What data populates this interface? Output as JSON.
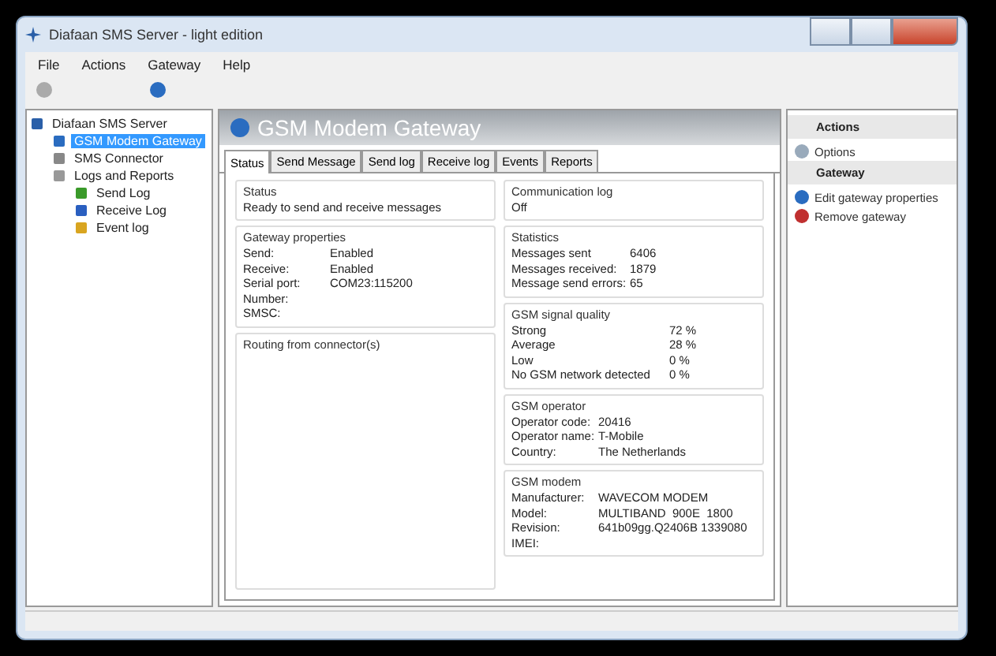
{
  "window": {
    "title": "Diafaan SMS Server - light edition"
  },
  "menu": [
    "File",
    "Actions",
    "Gateway",
    "Help"
  ],
  "tree": [
    {
      "label": "Diafaan SMS Server",
      "selected": false,
      "children": [
        {
          "label": "GSM Modem Gateway",
          "selected": true
        },
        {
          "label": "SMS Connector",
          "selected": false
        },
        {
          "label": "Logs and Reports",
          "selected": false,
          "children": [
            {
              "label": "Send Log",
              "selected": false
            },
            {
              "label": "Receive Log",
              "selected": false
            },
            {
              "label": "Event log",
              "selected": false
            }
          ]
        }
      ]
    }
  ],
  "header": {
    "title": "GSM Modem Gateway"
  },
  "tabs": [
    {
      "label": "Status",
      "selected": true
    },
    {
      "label": "Send Message",
      "selected": false
    },
    {
      "label": "Send log",
      "selected": false
    },
    {
      "label": "Receive log",
      "selected": false
    },
    {
      "label": "Events",
      "selected": false
    },
    {
      "label": "Reports",
      "selected": false
    }
  ],
  "left_groups": [
    {
      "title": "Status",
      "kind": "text",
      "text": "Ready to send and receive messages"
    },
    {
      "title": "Gateway properties",
      "kind": "pairs",
      "rows": [
        [
          "Send:",
          "Enabled"
        ],
        [
          "Receive:",
          "Enabled"
        ],
        [
          "Serial port:",
          "COM23:115200"
        ],
        [
          "Number:",
          ""
        ],
        [
          "SMSC:",
          ""
        ]
      ]
    },
    {
      "title": "Routing from connector(s)",
      "kind": "fill"
    }
  ],
  "right_groups": [
    {
      "title": "Communication log",
      "kind": "text",
      "text": "Off"
    },
    {
      "title": "Statistics",
      "kind": "stats",
      "rows": [
        [
          "Messages sent",
          "6406"
        ],
        [
          "Messages received:",
          "1879"
        ],
        [
          "Message send errors:",
          "65"
        ]
      ]
    },
    {
      "title": "GSM signal quality",
      "kind": "wide",
      "rows": [
        [
          "Strong",
          "72 %"
        ],
        [
          "Average",
          "28 %"
        ],
        [
          "Low",
          "0 %"
        ],
        [
          "No GSM network detected",
          "0 %"
        ]
      ]
    },
    {
      "title": "GSM operator",
      "kind": "pairs",
      "rows": [
        [
          "Operator code:",
          "20416"
        ],
        [
          "Operator name:",
          "T-Mobile"
        ],
        [
          "Country:",
          "The Netherlands"
        ]
      ]
    },
    {
      "title": "GSM modem",
      "kind": "pairs",
      "rows": [
        [
          "Manufacturer:",
          "WAVECOM MODEM"
        ],
        [
          "Model:",
          "MULTIBAND  900E  1800"
        ],
        [
          "Revision:",
          "641b09gg.Q2406B 1339080"
        ],
        [
          "IMEI:",
          ""
        ]
      ]
    }
  ],
  "actions": [
    {
      "kind": "heading",
      "label": "Actions"
    },
    {
      "kind": "item",
      "label": "Options"
    },
    {
      "kind": "heading",
      "label": "Gateway"
    },
    {
      "kind": "item",
      "label": "Edit gateway properties"
    },
    {
      "kind": "item",
      "label": "Remove gateway"
    }
  ]
}
